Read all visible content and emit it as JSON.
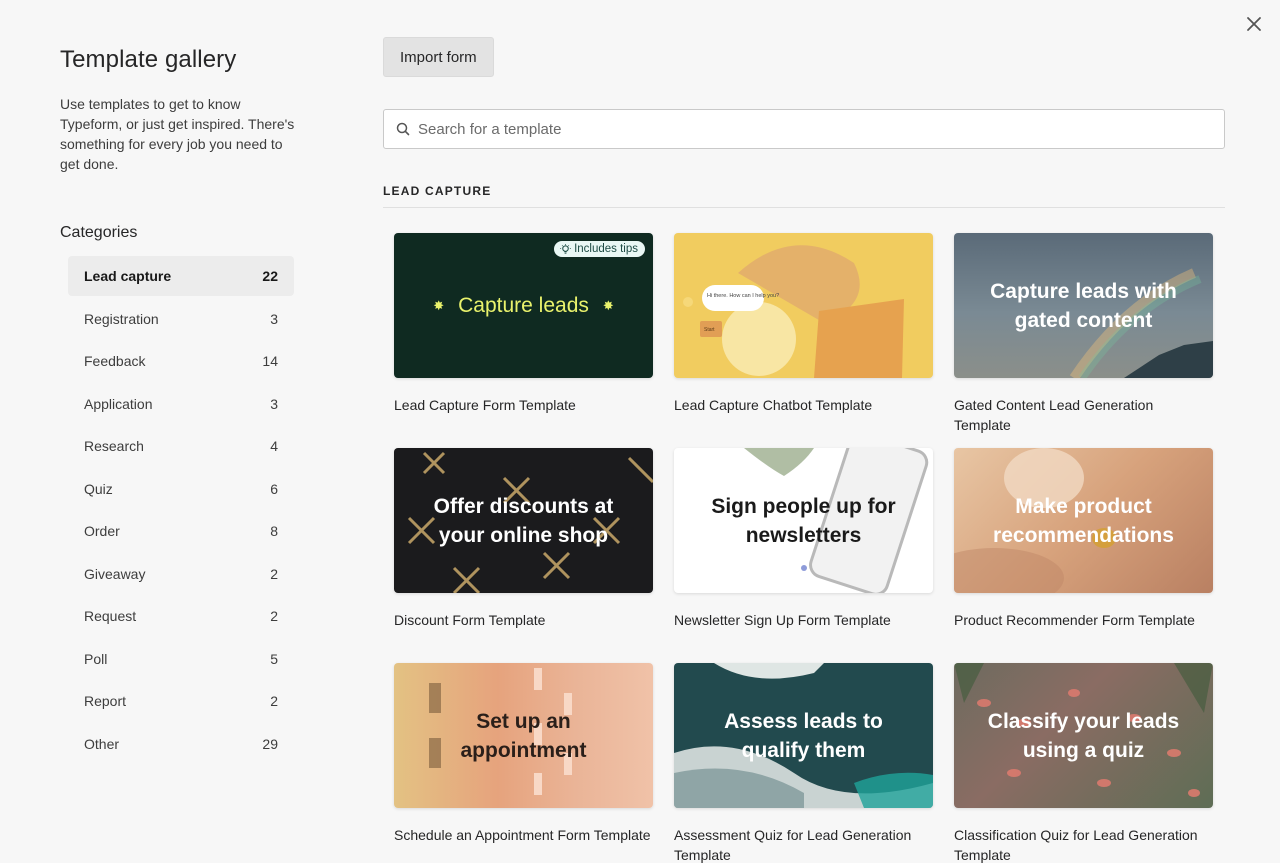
{
  "sidebar": {
    "title": "Template gallery",
    "description": "Use templates to get to know Typeform, or just get inspired. There's something for every job you need to get done.",
    "categories_heading": "Categories",
    "categories": [
      {
        "label": "Lead capture",
        "count": "22"
      },
      {
        "label": "Registration",
        "count": "3"
      },
      {
        "label": "Feedback",
        "count": "14"
      },
      {
        "label": "Application",
        "count": "3"
      },
      {
        "label": "Research",
        "count": "4"
      },
      {
        "label": "Quiz",
        "count": "6"
      },
      {
        "label": "Order",
        "count": "8"
      },
      {
        "label": "Giveaway",
        "count": "2"
      },
      {
        "label": "Request",
        "count": "2"
      },
      {
        "label": "Poll",
        "count": "5"
      },
      {
        "label": "Report",
        "count": "2"
      },
      {
        "label": "Other",
        "count": "29"
      }
    ]
  },
  "main": {
    "import_label": "Import form",
    "search_placeholder": "Search for a template",
    "section_title": "LEAD CAPTURE",
    "badge": "Includes tips",
    "templates": [
      {
        "thumb_text": "Capture leads",
        "label": "Lead Capture Form Template"
      },
      {
        "thumb_text": "",
        "label": "Lead Capture Chatbot Template",
        "chat_text": "Hi there. How can I help you?",
        "chat_button": "Start"
      },
      {
        "thumb_text": "Capture leads with gated content",
        "label": "Gated Content Lead Generation Template"
      },
      {
        "thumb_text": "Offer discounts at your online shop",
        "label": "Discount Form Template"
      },
      {
        "thumb_text": "Sign people up for newsletters",
        "label": "Newsletter Sign Up Form Template"
      },
      {
        "thumb_text": "Make product recommendations",
        "label": "Product Recommender Form Template"
      },
      {
        "thumb_text": "Set up an appointment",
        "label": "Schedule an Appointment Form Template"
      },
      {
        "thumb_text": "Assess leads to qualify them",
        "label": "Assessment Quiz for Lead Generation Template"
      },
      {
        "thumb_text": "Classify your leads using a quiz",
        "label": "Classification Quiz for Lead Generation Template"
      }
    ]
  },
  "colors": {
    "background": "#f7f7f7",
    "active_category": "#ececec",
    "accent_lime": "#e9f26c"
  }
}
